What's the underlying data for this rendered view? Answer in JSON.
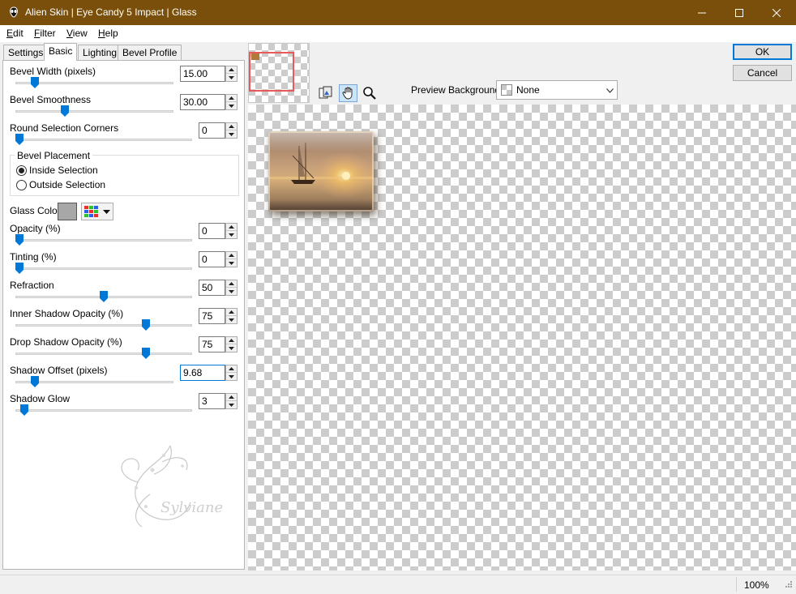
{
  "window": {
    "title": "Alien Skin | Eye Candy 5 Impact | Glass",
    "colors": {
      "titlebar": "#7a4f0b",
      "accent": "#0078d7"
    }
  },
  "menu": [
    {
      "label": "Edit",
      "mnemonic": "E",
      "rest": "dit"
    },
    {
      "label": "Filter",
      "mnemonic": "F",
      "rest": "ilter"
    },
    {
      "label": "View",
      "mnemonic": "V",
      "rest": "iew"
    },
    {
      "label": "Help",
      "mnemonic": "H",
      "rest": "elp"
    }
  ],
  "tabs": [
    "Settings",
    "Basic",
    "Lighting",
    "Bevel Profile"
  ],
  "active_tab": "Basic",
  "controls": {
    "bevel_width": {
      "label": "Bevel Width (pixels)",
      "value": "15.00",
      "slider": 0.1
    },
    "bevel_smoothness": {
      "label": "Bevel Smoothness",
      "value": "30.00",
      "slider": 0.3
    },
    "round_corners": {
      "label": "Round Selection Corners",
      "value": "0",
      "slider": 0.0
    },
    "bevel_placement": {
      "label": "Bevel Placement",
      "inside": "Inside Selection",
      "outside": "Outside Selection",
      "selected": "inside"
    },
    "glass_color": {
      "label": "Glass Color",
      "color": "#a7a7a7"
    },
    "opacity": {
      "label": "Opacity (%)",
      "value": "0",
      "slider": 0.0
    },
    "tinting": {
      "label": "Tinting (%)",
      "value": "0",
      "slider": 0.0
    },
    "refraction": {
      "label": "Refraction",
      "value": "50",
      "slider": 0.5
    },
    "inner_shadow_opacity": {
      "label": "Inner Shadow Opacity (%)",
      "value": "75",
      "slider": 0.75
    },
    "drop_shadow_opacity": {
      "label": "Drop Shadow Opacity (%)",
      "value": "75",
      "slider": 0.75
    },
    "shadow_offset": {
      "label": "Shadow Offset (pixels)",
      "value": "9.68",
      "slider": 0.1
    },
    "shadow_glow": {
      "label": "Shadow Glow",
      "value": "3",
      "slider": 0.03
    }
  },
  "watermark": "Sylviane",
  "preview": {
    "bg_label": "Preview Background:",
    "bg_value": "None"
  },
  "buttons": {
    "ok": "OK",
    "cancel": "Cancel"
  },
  "status": {
    "zoom": "100%"
  },
  "icons": {
    "app": "alien-skin-icon",
    "tools": [
      "toggle-preview-icon",
      "hand-icon",
      "zoom-icon"
    ]
  }
}
